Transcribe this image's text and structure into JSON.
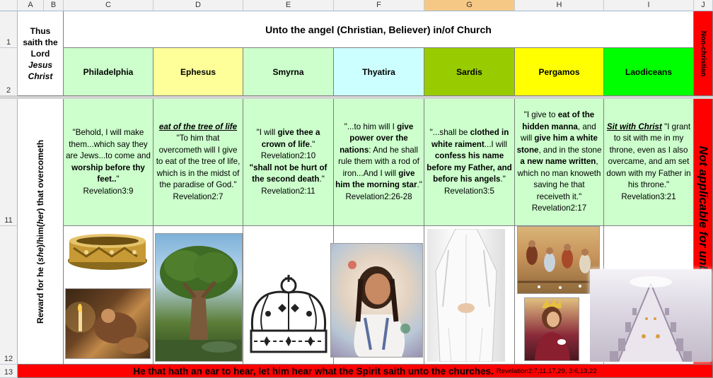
{
  "columns": [
    "A",
    "B",
    "C",
    "D",
    "E",
    "F",
    "G",
    "H",
    "I",
    "J"
  ],
  "rows": [
    "1",
    "2",
    "11",
    "12",
    "13"
  ],
  "header": {
    "title": "Unto the angel (Christian, Believer) in/of Church",
    "thus_line1": "Thus",
    "thus_line2": "saith the",
    "thus_line3": "Lord",
    "thus_line4": "Jesus",
    "thus_line5": "Christ",
    "non_christian": "Non-christian"
  },
  "reward_label": {
    "pre": "Reward for he (",
    "she": "she",
    "mid": ")/him(",
    "her": "her",
    "post": ") that overcometh"
  },
  "churches": [
    {
      "name": "Philadelphia",
      "color": "#ccffcc"
    },
    {
      "name": "Ephesus",
      "color": "#ffff99"
    },
    {
      "name": "Smyrna",
      "color": "#ccffcc"
    },
    {
      "name": "Thyatira",
      "color": "#ccffff"
    },
    {
      "name": "Sardis",
      "color": "#99cc00"
    },
    {
      "name": "Pergamos",
      "color": "#ffff00"
    },
    {
      "name": "Laodiceans",
      "color": "#00ff00"
    }
  ],
  "rewards": {
    "philadelphia": {
      "t1": "\"Behold, I will make them...which say they are Jews...to come and ",
      "b1": "worship before thy feet..",
      "t2": "\"",
      "ref": "Revelation3:9"
    },
    "ephesus": {
      "b1": "eat of the tree of life",
      "t1": " \"To him that overcometh will I give to eat of the tree of life, which is in the midst of the paradise of God.\"",
      "ref": "Revelation2:7"
    },
    "smyrna": {
      "t1": "\"I will ",
      "b1": "give thee a crown of life",
      "t2": ".\"",
      "ref1": "Revelation2:10",
      "b2": "\"shall not be hurt of the second death",
      "t3": ".\"",
      "ref": "Revelation2:11"
    },
    "thyatira": {
      "t1": "\"...to him will I ",
      "b1": "give power over the nations",
      "t2": ": And he shall rule them with a rod of iron...And I will ",
      "b2": "give him the morning star",
      "t3": ".\"",
      "ref": "Revelation2:26-28"
    },
    "sardis": {
      "t1": "\"...shall be ",
      "b1": "clothed in white raiment",
      "t2": "...I will ",
      "b2": "confess his name before my Father, and before his angels",
      "t3": ".\"",
      "ref": "Revelation3:5"
    },
    "pergamos": {
      "t1": "\"I give to ",
      "b1": "eat of the hidden manna",
      "t2": ", and will ",
      "b2": "give him a white stone",
      "t3": ", and in the stone ",
      "b3": "a new name written",
      "t4": ", which no man knoweth saving he that receiveth it.\"",
      "ref": "Revelation2:17"
    },
    "laodiceans": {
      "b1": "Sit with Christ",
      "t1": " \"I grant to sit with me in my throne, even as I also overcame, and am set down with my Father in his throne.\"",
      "ref": "Revelation3:21"
    }
  },
  "not_applicable": "Not applicable for unbelievers",
  "footer": {
    "main": "He that hath an ear to hear, let him hear what the Spirit saith unto the churches.",
    "refs": "Revelation2:7,11,17,29, 3:6,13,22"
  },
  "colors": {
    "red": "#ff0000",
    "selected_header": "#f6c886",
    "grid": "#808080"
  }
}
